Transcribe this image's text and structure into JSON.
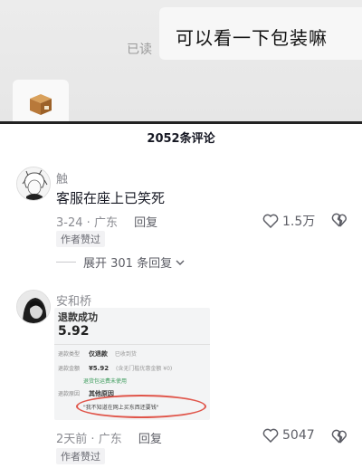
{
  "chat": {
    "sent_message": "可以看一下包装嘛",
    "read_status": "已读",
    "received_icon": "package-box-icon"
  },
  "comments_header": {
    "title": "2052条评论"
  },
  "comments": [
    {
      "username": "触",
      "text": "客服在座上已笑死",
      "date": "3-24",
      "location": "广东",
      "reply_label": "回复",
      "likes": "1.5万",
      "badge": "作者赞过",
      "expand_label": "展开 301 条回复"
    },
    {
      "username": "安和桥",
      "date": "2天前",
      "location": "广东",
      "reply_label": "回复",
      "likes": "5047",
      "badge": "作者赞过",
      "image": {
        "title": "退款成功",
        "amount": "5.92",
        "rows": [
          {
            "label": "退款类型",
            "value": "仅退款",
            "note": "已收到货"
          },
          {
            "label": "退款金额",
            "value": "¥5.92",
            "note": "(含无门槛优惠金额 ¥0)"
          },
          {
            "label": "",
            "value": "",
            "note": "退货包运费未使用"
          },
          {
            "label": "退款原因",
            "value": "其他原因",
            "note": ""
          }
        ],
        "quote": "\"我不知道在网上买东西还要钱\""
      }
    }
  ],
  "colors": {
    "text_primary": "#161823",
    "text_secondary": "#8a8b91",
    "highlight_circle": "#e0554a"
  }
}
